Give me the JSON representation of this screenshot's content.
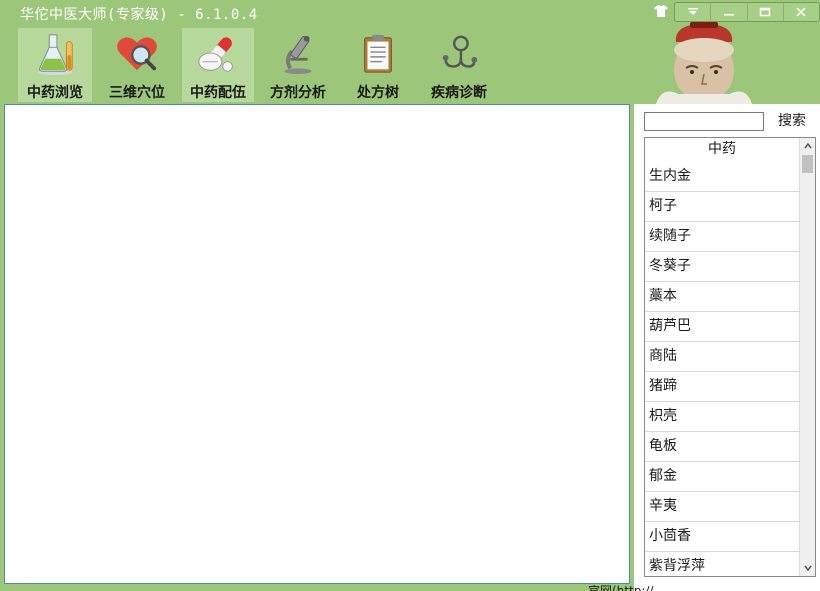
{
  "window": {
    "title": "华佗中医大师(专家级) - 6.1.0.4"
  },
  "toolbar": {
    "items": [
      {
        "label": "中药浏览",
        "icon": "flask-icon",
        "active": true
      },
      {
        "label": "三维穴位",
        "icon": "heart-magnifier-icon",
        "active": false
      },
      {
        "label": "中药配伍",
        "icon": "pills-icon",
        "active": true
      },
      {
        "label": "方剂分析",
        "icon": "microscope-icon",
        "active": false
      },
      {
        "label": "处方树",
        "icon": "clipboard-icon",
        "active": false
      },
      {
        "label": "疾病诊断",
        "icon": "stethoscope-icon",
        "active": false
      }
    ]
  },
  "search": {
    "value": "",
    "button_label": "搜索"
  },
  "herb_list": {
    "header": "中药",
    "items": [
      "生内金",
      "柯子",
      "续随子",
      "冬葵子",
      "藁本",
      "葫芦巴",
      "商陆",
      "猪蹄",
      "枳壳",
      "龟板",
      "郁金",
      "辛夷",
      "小茴香",
      "紫背浮萍"
    ]
  },
  "status": {
    "text": "官网(http://"
  },
  "colors": {
    "app_background": "#9cc67a",
    "active_tool": "#b6d89b",
    "panel_border": "#4b8fb0"
  }
}
